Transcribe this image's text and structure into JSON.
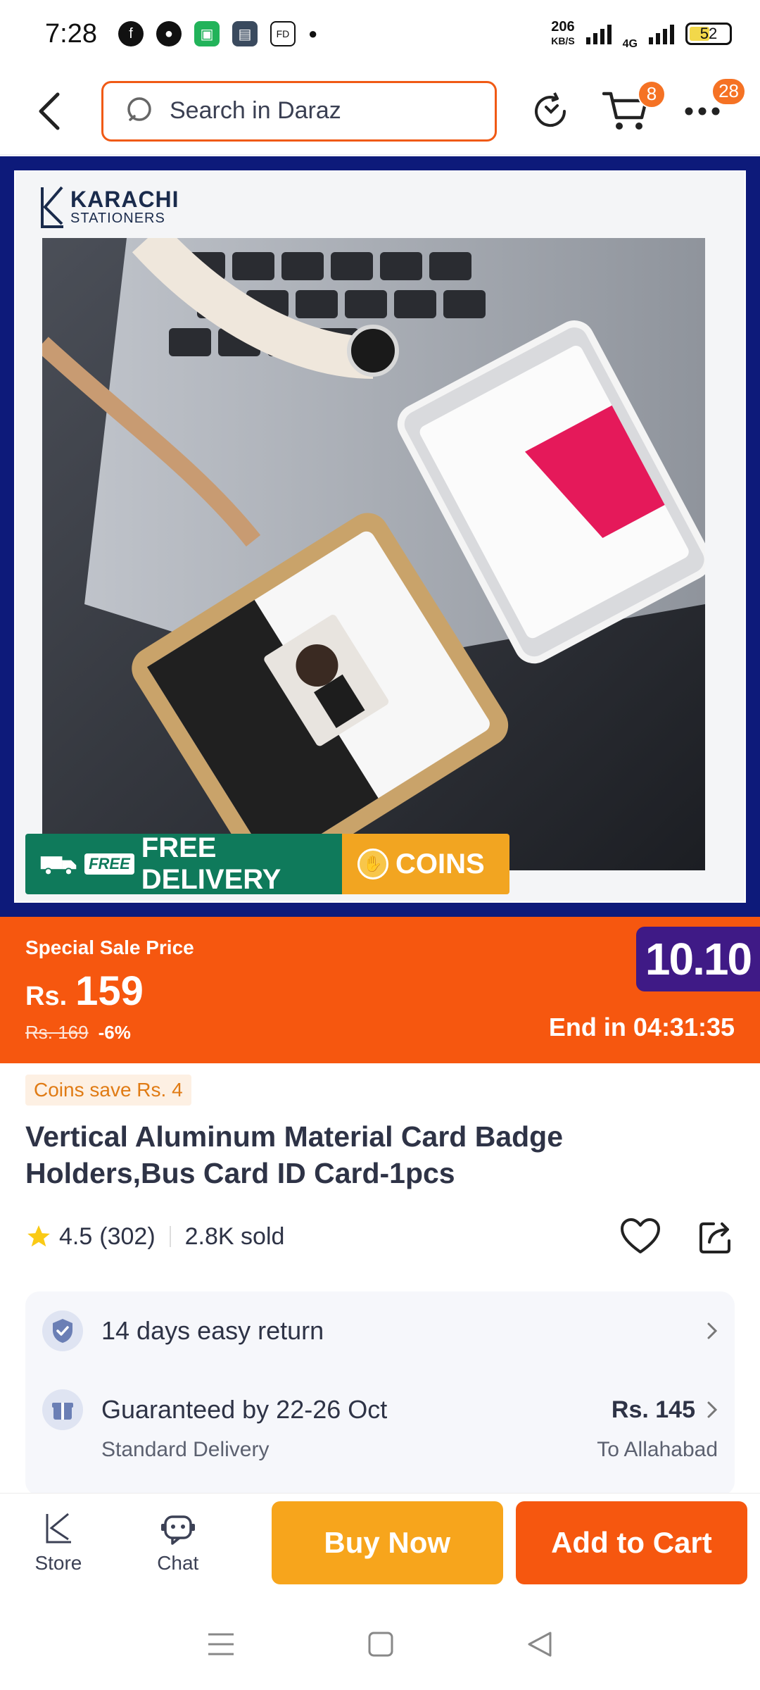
{
  "status": {
    "time": "7:28",
    "net_speed": "206",
    "net_unit": "KB/S",
    "net_type": "4G",
    "battery": "52",
    "battery_fraction": 0.52
  },
  "nav": {
    "search_placeholder": "Search in Daraz",
    "cart_count": "8",
    "more_count": "28"
  },
  "product_image": {
    "store_logo_name": "KARACHI",
    "store_logo_sub": "STATIONERS",
    "free_tag": "FREE",
    "free_delivery": "FREE DELIVERY",
    "coins": "COINS"
  },
  "price": {
    "label": "Special Sale Price",
    "currency": "Rs.",
    "amount": "159",
    "original": "Rs. 169",
    "discount": "-6%",
    "event": "10.10",
    "ends": "End in 04:31:35"
  },
  "coins_save": "Coins save Rs. 4",
  "title": "Vertical Aluminum Material Card Badge Holders,Bus Card ID Card-1pcs",
  "rating": {
    "score": "4.5",
    "count": "(302)",
    "sold": "2.8K sold"
  },
  "services": {
    "return": "14 days easy return",
    "delivery": "Guaranteed by 22-26 Oct",
    "delivery_type": "Standard Delivery",
    "fee": "Rs. 145",
    "destination": "To Allahabad"
  },
  "bottom": {
    "store": "Store",
    "chat": "Chat",
    "buy_now": "Buy Now",
    "add_to_cart": "Add to Cart"
  },
  "colors": {
    "brand_orange": "#f6570f",
    "buy_yellow": "#f7a51c",
    "free_green": "#0f7a5b",
    "frame_navy": "#0d1a7a"
  }
}
